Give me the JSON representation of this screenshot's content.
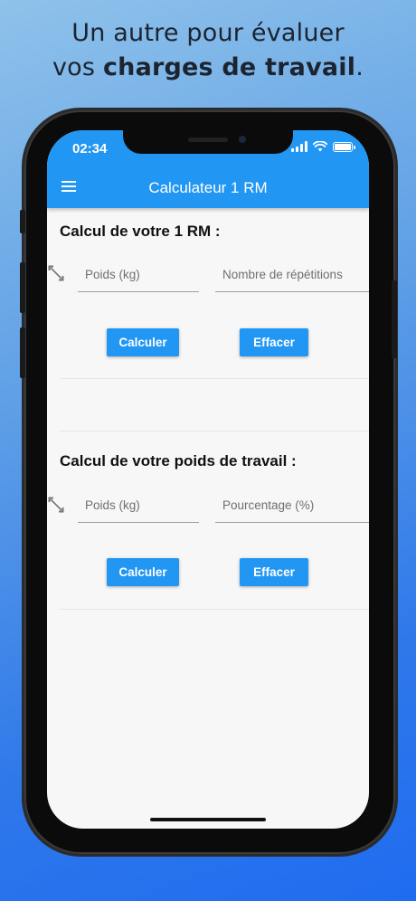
{
  "headline": {
    "line1": "Un autre pour évaluer",
    "line2_prefix": "vos",
    "line2_bold": "charges de travail",
    "line2_suffix": "."
  },
  "status_bar": {
    "time": "02:34"
  },
  "appbar": {
    "title": "Calculateur 1 RM",
    "menu_icon": "hamburger-menu-icon"
  },
  "section1": {
    "title": "Calcul de votre 1 RM :",
    "weight_placeholder": "Poids (kg)",
    "reps_placeholder": "Nombre de répétitions",
    "calculate_label": "Calculer",
    "clear_label": "Effacer"
  },
  "section2": {
    "title": "Calcul de votre poids de travail :",
    "weight_placeholder": "Poids (kg)",
    "percent_placeholder": "Pourcentage (%)",
    "calculate_label": "Calculer",
    "clear_label": "Effacer"
  },
  "colors": {
    "primary": "#2196f3",
    "background": "#f7f7f7"
  }
}
